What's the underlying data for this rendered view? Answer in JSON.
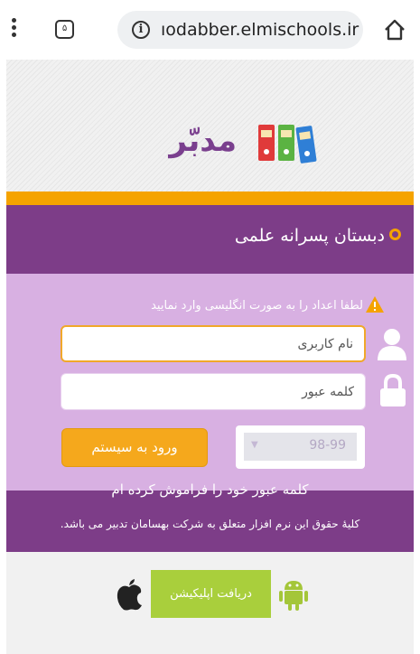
{
  "browser": {
    "tab_count": "۵",
    "url": "ıodabber.elmischools.ir"
  },
  "logo": {
    "text": "مدبّر"
  },
  "school": {
    "name": "دبستان پسرانه علمی"
  },
  "form": {
    "notice": "لطفا اعداد را به صورت انگلیسی وارد نمایید",
    "username_placeholder": "نام کاربری",
    "password_placeholder": "کلمه عبور",
    "login_label": "ورود به سیستم",
    "year_value": "98-99",
    "year_caret": "▼"
  },
  "footer": {
    "forgot_password": "کلمه عبور خود را فراموش کرده ام",
    "copyright": "کلیهٔ حقوق این نرم افزار متعلق به شرکت بهسامان تدبیر می باشد."
  },
  "apps": {
    "download_label": "دریافت اپلیکیشن"
  },
  "colors": {
    "purple": "#7d3d88",
    "light_purple": "#d8b0e2",
    "orange": "#f5a300",
    "green": "#a9cf3c"
  }
}
